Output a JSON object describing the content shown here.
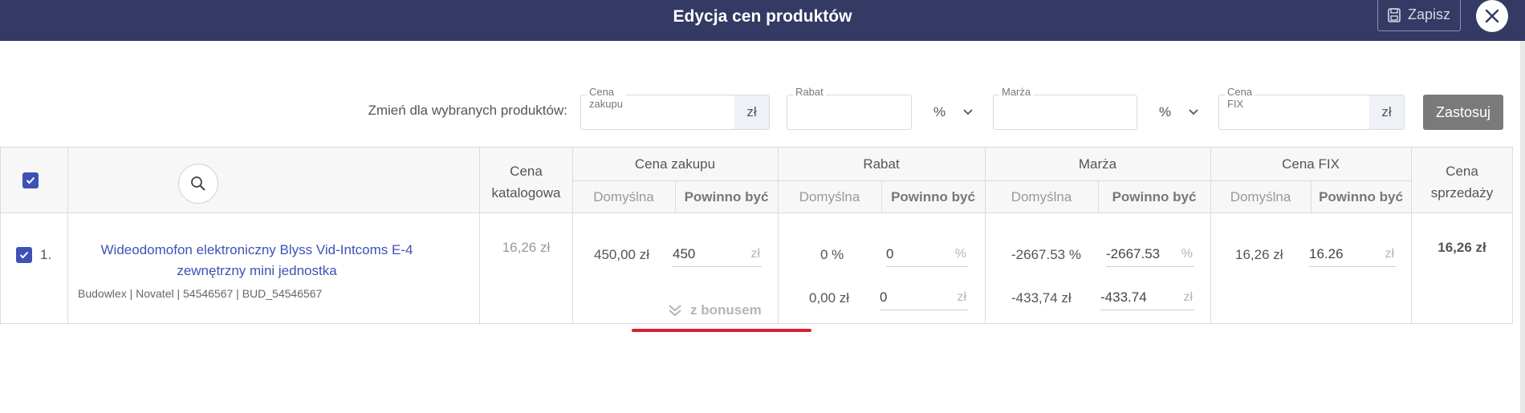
{
  "header": {
    "title": "Edycja cen produktów",
    "save_label": "Zapisz",
    "accent": "#343a63"
  },
  "filters": {
    "label": "Zmień dla wybranych produktów:",
    "cena_zakupu": {
      "label": "Cena zakupu",
      "value": "",
      "unit": "zł"
    },
    "rabat": {
      "label": "Rabat",
      "value": "",
      "unit": "%"
    },
    "marza": {
      "label": "Marża",
      "value": "",
      "unit": "%"
    },
    "cena_fix": {
      "label": "Cena FIX",
      "value": "",
      "unit": "zł"
    },
    "apply_label": "Zastosuj"
  },
  "table": {
    "headers": {
      "cena_katalogowa_1": "Cena",
      "cena_katalogowa_2": "katalogowa",
      "cena_zakupu": "Cena zakupu",
      "rabat": "Rabat",
      "marza": "Marża",
      "cena_fix": "Cena FIX",
      "cena_sprzedazy_1": "Cena",
      "cena_sprzedazy_2": "sprzedaży",
      "domyslna": "Domyślna",
      "powinno_byc": "Powinno być"
    },
    "row": {
      "index": "1.",
      "name_line1": "Wideodomofon elektroniczny Blyss Vid-Intcoms E-4",
      "name_line2": "zewnętrzny mini jednostka",
      "meta": "Budowlex | Novatel | 54546567 | BUD_54546567",
      "cena_katalogowa": "16,26 zł",
      "cena_zakupu_default": "450,00 zł",
      "cena_zakupu_value": "450",
      "cena_zakupu_unit": "zł",
      "bonus_label": "z bonusem",
      "rabat_default_pct": "0 %",
      "rabat_value_pct": "0",
      "rabat_unit_pct": "%",
      "rabat_default_zl": "0,00 zł",
      "rabat_value_zl": "0",
      "rabat_unit_zl": "zł",
      "marza_default_pct": "-2667.53 %",
      "marza_value_pct": "-2667.53",
      "marza_unit_pct": "%",
      "marza_default_zl": "-433,74 zł",
      "marza_value_zl": "-433.74",
      "marza_unit_zl": "zł",
      "fix_default": "16,26 zł",
      "fix_value": "16.26",
      "fix_unit": "zł",
      "cena_sprzedazy": "16,26 zł"
    }
  }
}
